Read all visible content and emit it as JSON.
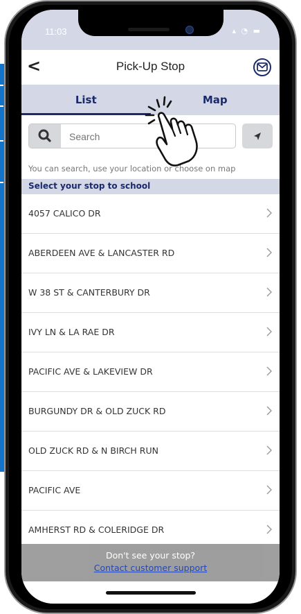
{
  "status_bar": {
    "time": "11:03",
    "icons": "▴ ◔ ▬"
  },
  "header": {
    "title": "Pick-Up Stop",
    "back_glyph": "<"
  },
  "tabs": [
    {
      "label": "List",
      "active": true
    },
    {
      "label": "Map",
      "active": false
    }
  ],
  "search": {
    "placeholder": "Search",
    "value": ""
  },
  "hint": "You can search, use your location or choose on map",
  "section_title": "Select your stop to school",
  "stops": [
    "4057 CALICO DR",
    "ABERDEEN AVE & LANCASTER RD",
    "W 38 ST & CANTERBURY DR",
    "IVY LN & LA RAE DR",
    "PACIFIC AVE & LAKEVIEW DR",
    "BURGUNDY DR & OLD ZUCK RD",
    "OLD ZUCK RD & N BIRCH RUN",
    "PACIFIC AVE",
    "AMHERST RD & COLERIDGE DR"
  ],
  "footer": {
    "question": "Don't see your stop?",
    "link": "Contact customer support"
  },
  "colors": {
    "accent": "#1b2a6b",
    "tab_bg": "#d4d7e6",
    "link": "#1b3fb0",
    "footer_bg": "#9b9b9b",
    "side_bar": "#1273c8"
  },
  "icons": {
    "back": "chevron-left-icon",
    "mail": "mail-icon",
    "search": "search-icon",
    "location": "location-arrow-icon",
    "row": "chevron-right-icon",
    "pointer": "tap-hand-icon"
  }
}
